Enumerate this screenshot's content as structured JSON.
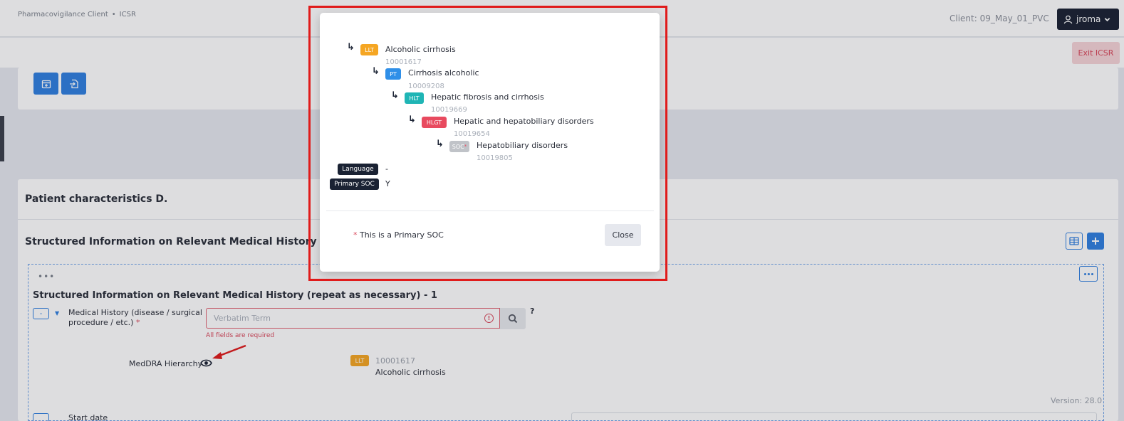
{
  "header": {
    "client_label": "Client: 09_May_01_PVC",
    "user_name": "jroma"
  },
  "breadcrumb": {
    "items": [
      "Pharmacovigilance Client",
      "ICSR"
    ],
    "separator": "•"
  },
  "exit_button": "Exit ICSR",
  "section": {
    "title": "Patient characteristics D.",
    "subsection_title": "Structured Information on Relevant Medical History (repeat as",
    "item_title": "Structured Information on Relevant Medical History (repeat as necessary) - 1",
    "medical_history": {
      "label": "Medical History (disease / surgical procedure / etc.)",
      "required_mark": "*",
      "placeholder": "Verbatim Term",
      "error": "All fields are required",
      "help": "?",
      "collapse": "-"
    },
    "meddra": {
      "label": "MedDRA Hierarchy",
      "level": "LLT",
      "code": "10001617",
      "name": "Alcoholic cirrhosis"
    },
    "version": "Version: 28.0",
    "start_date_label": "Start date"
  },
  "modal": {
    "hierarchy": [
      {
        "level": "LLT",
        "name": "Alcoholic cirrhosis",
        "code": "10001617",
        "color": "#f5a623"
      },
      {
        "level": "PT",
        "name": "Cirrhosis alcoholic",
        "code": "10009208",
        "color": "#2f8fe8"
      },
      {
        "level": "HLT",
        "name": "Hepatic fibrosis and cirrhosis",
        "code": "10019669",
        "color": "#1fb5b5"
      },
      {
        "level": "HLGT",
        "name": "Hepatic and hepatobiliary disorders",
        "code": "10019654",
        "color": "#e84a5f"
      },
      {
        "level": "SOC",
        "name": "Hepatobiliary disorders",
        "code": "10019805",
        "color": "#c0c3c8",
        "primary_mark": "*"
      }
    ],
    "arrow_glyph": "↳",
    "language_label": "Language",
    "language_value": "-",
    "primary_soc_label": "Primary SOC",
    "primary_soc_value": "Y",
    "footnote_mark": "*",
    "footnote": "This is a Primary SOC",
    "close_label": "Close"
  },
  "colors": {
    "accent": "#2f7fe0",
    "error": "#d9475a",
    "highlight": "#e01b1b",
    "dark": "#1a2233"
  }
}
